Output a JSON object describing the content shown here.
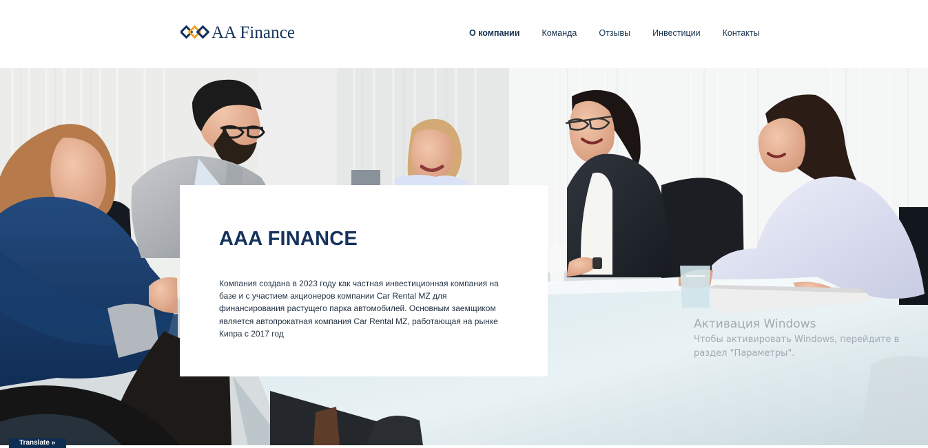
{
  "header": {
    "logo_text": "AA Finance",
    "brand_colors": {
      "navy": "#15325c",
      "gold": "#f0a42a"
    }
  },
  "navigation": {
    "items": [
      {
        "label": "О компании",
        "active": true
      },
      {
        "label": "Команда",
        "active": false
      },
      {
        "label": "Отзывы",
        "active": false
      },
      {
        "label": "Инвестиции",
        "active": false
      },
      {
        "label": "Контакты",
        "active": false
      }
    ]
  },
  "hero": {
    "image_description": "business-team-meeting-photo"
  },
  "about": {
    "title": "AAA FINANCE",
    "text": "Компания создана в 2023 году как частная инвестиционная компания на базе и с участием акционеров компании Car Rental MZ для финансирования растущего парка автомобилей. Основным заемщиком является автопрокатная компания Car Rental MZ, работающая на рынке Кипра с 2017 год"
  },
  "system_overlay": {
    "windows_title": "Активация Windows",
    "windows_message": "Чтобы активировать Windows, перейдите в раздел \"Параметры\"."
  },
  "translate": {
    "label": "Translate »"
  }
}
